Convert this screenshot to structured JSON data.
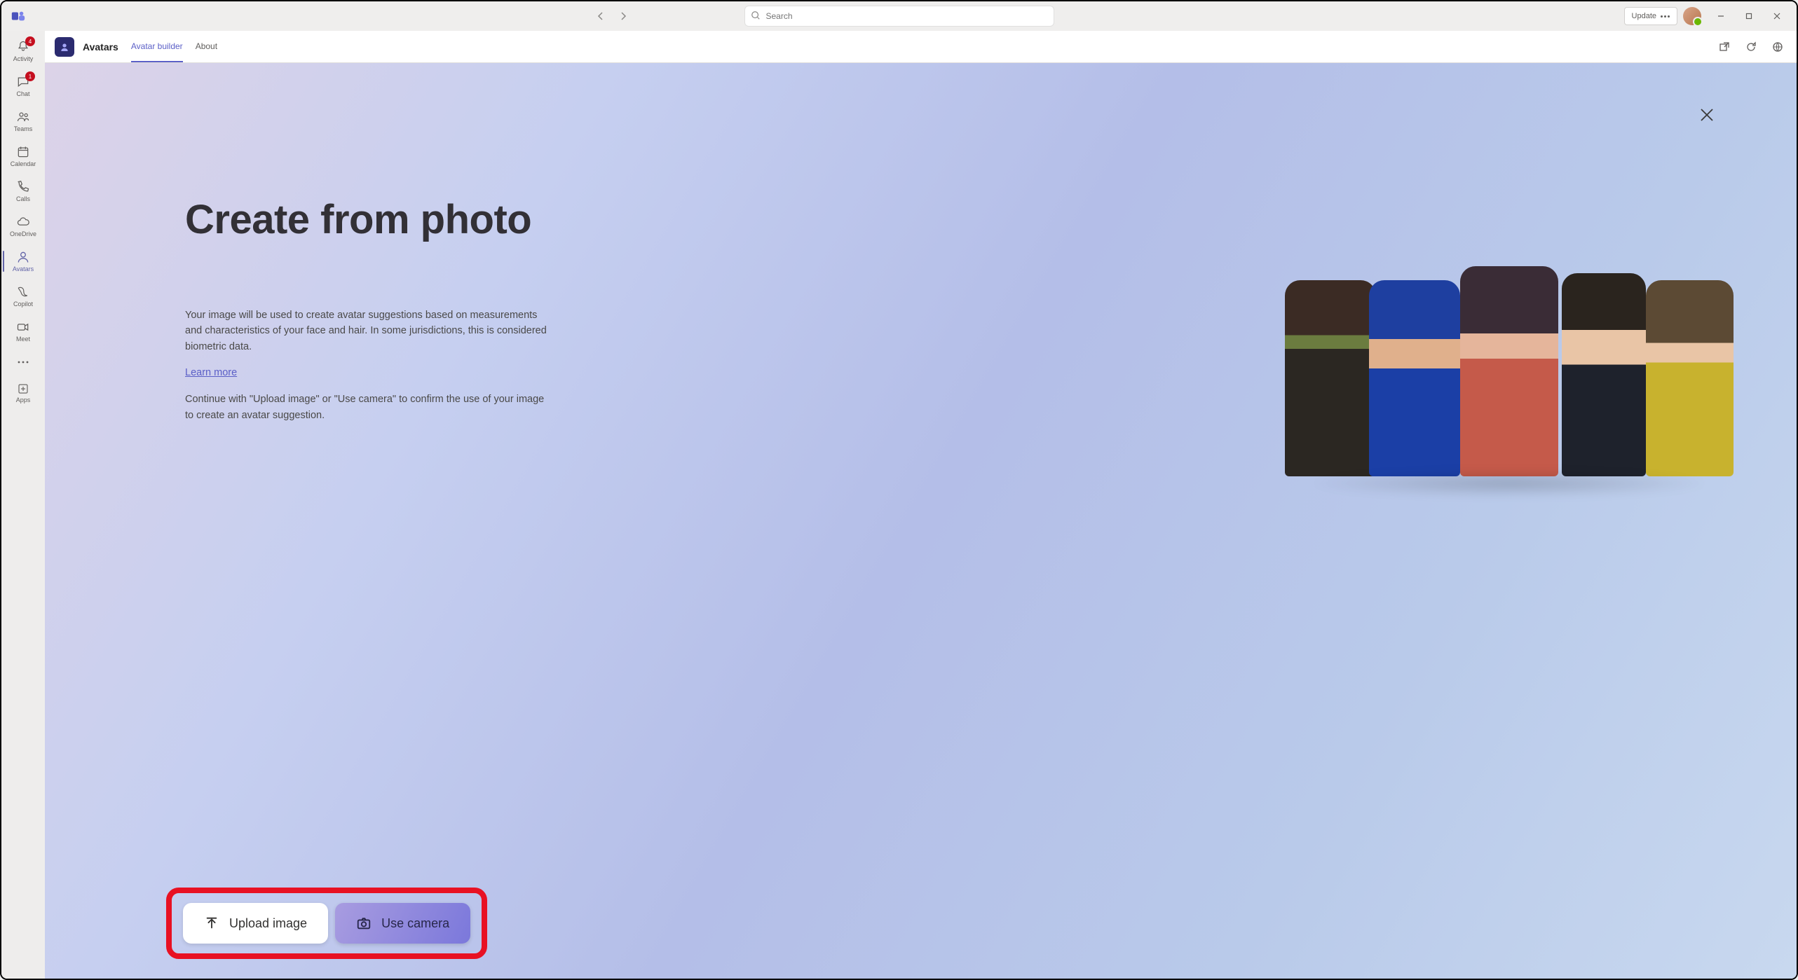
{
  "titlebar": {
    "search_placeholder": "Search",
    "update_label": "Update"
  },
  "rail": {
    "items": [
      {
        "label": "Activity",
        "badge": "4"
      },
      {
        "label": "Chat",
        "badge": "1"
      },
      {
        "label": "Teams"
      },
      {
        "label": "Calendar"
      },
      {
        "label": "Calls"
      },
      {
        "label": "OneDrive"
      },
      {
        "label": "Avatars"
      },
      {
        "label": "Copilot"
      },
      {
        "label": "Meet"
      }
    ],
    "apps_label": "Apps"
  },
  "subheader": {
    "app_title": "Avatars",
    "tabs": [
      {
        "label": "Avatar builder"
      },
      {
        "label": "About"
      }
    ]
  },
  "page": {
    "title": "Create from photo",
    "description": "Your image will be used to create avatar suggestions based on measurements and characteristics of your face and hair. In some jurisdictions, this is considered biometric data.",
    "learn_more": "Learn more",
    "description2": "Continue with \"Upload image\" or \"Use camera\" to confirm the use of your image to create an avatar suggestion.",
    "upload_label": "Upload image",
    "camera_label": "Use camera"
  }
}
